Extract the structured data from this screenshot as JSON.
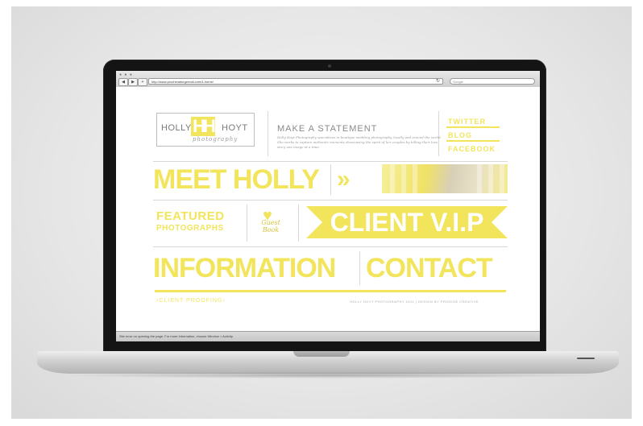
{
  "browser": {
    "url": "http://www.prochimaturgemail.com/4-home/",
    "search_placeholder": "Google",
    "back": "◀",
    "forward": "▶",
    "add": "+",
    "reload": "↻",
    "window_dots": "● ● ●",
    "status_text": "Site error on opening the page. For more information, choose Window > Activity."
  },
  "site": {
    "logo_left": "HOLLY",
    "logo_mark": "HH",
    "logo_right": "HOYT",
    "logo_script": "photography",
    "statement_title": "MAKE A STATEMENT",
    "statement_body": "Holly Hoyt Photography specializes in boutique wedding photography, locally and around the world. She works to capture authentic moments showcasing the spirit of her couples by telling their love story one image at a time.",
    "social": [
      "TWITTER",
      "BLOG",
      "FACEBOOK"
    ],
    "meet": "MEET HOLLY",
    "chevrons": "»",
    "featured_line1": "FEATURED",
    "featured_line2": "PHOTOGRAPHS",
    "guest_book": "Guest Book",
    "client_vip": "CLIENT V.I.P",
    "information": "INFORMATION",
    "contact": "CONTACT",
    "client_proofing": "›CLIENT PROOFING‹",
    "credit": "HOLLY HOYT PHOTOGRAPHY 2011 | DESIGN BY PRODIGE CREATIVE"
  },
  "colors": {
    "accent_yellow": "#f2e55c",
    "text_gray": "#8a8a8a"
  }
}
